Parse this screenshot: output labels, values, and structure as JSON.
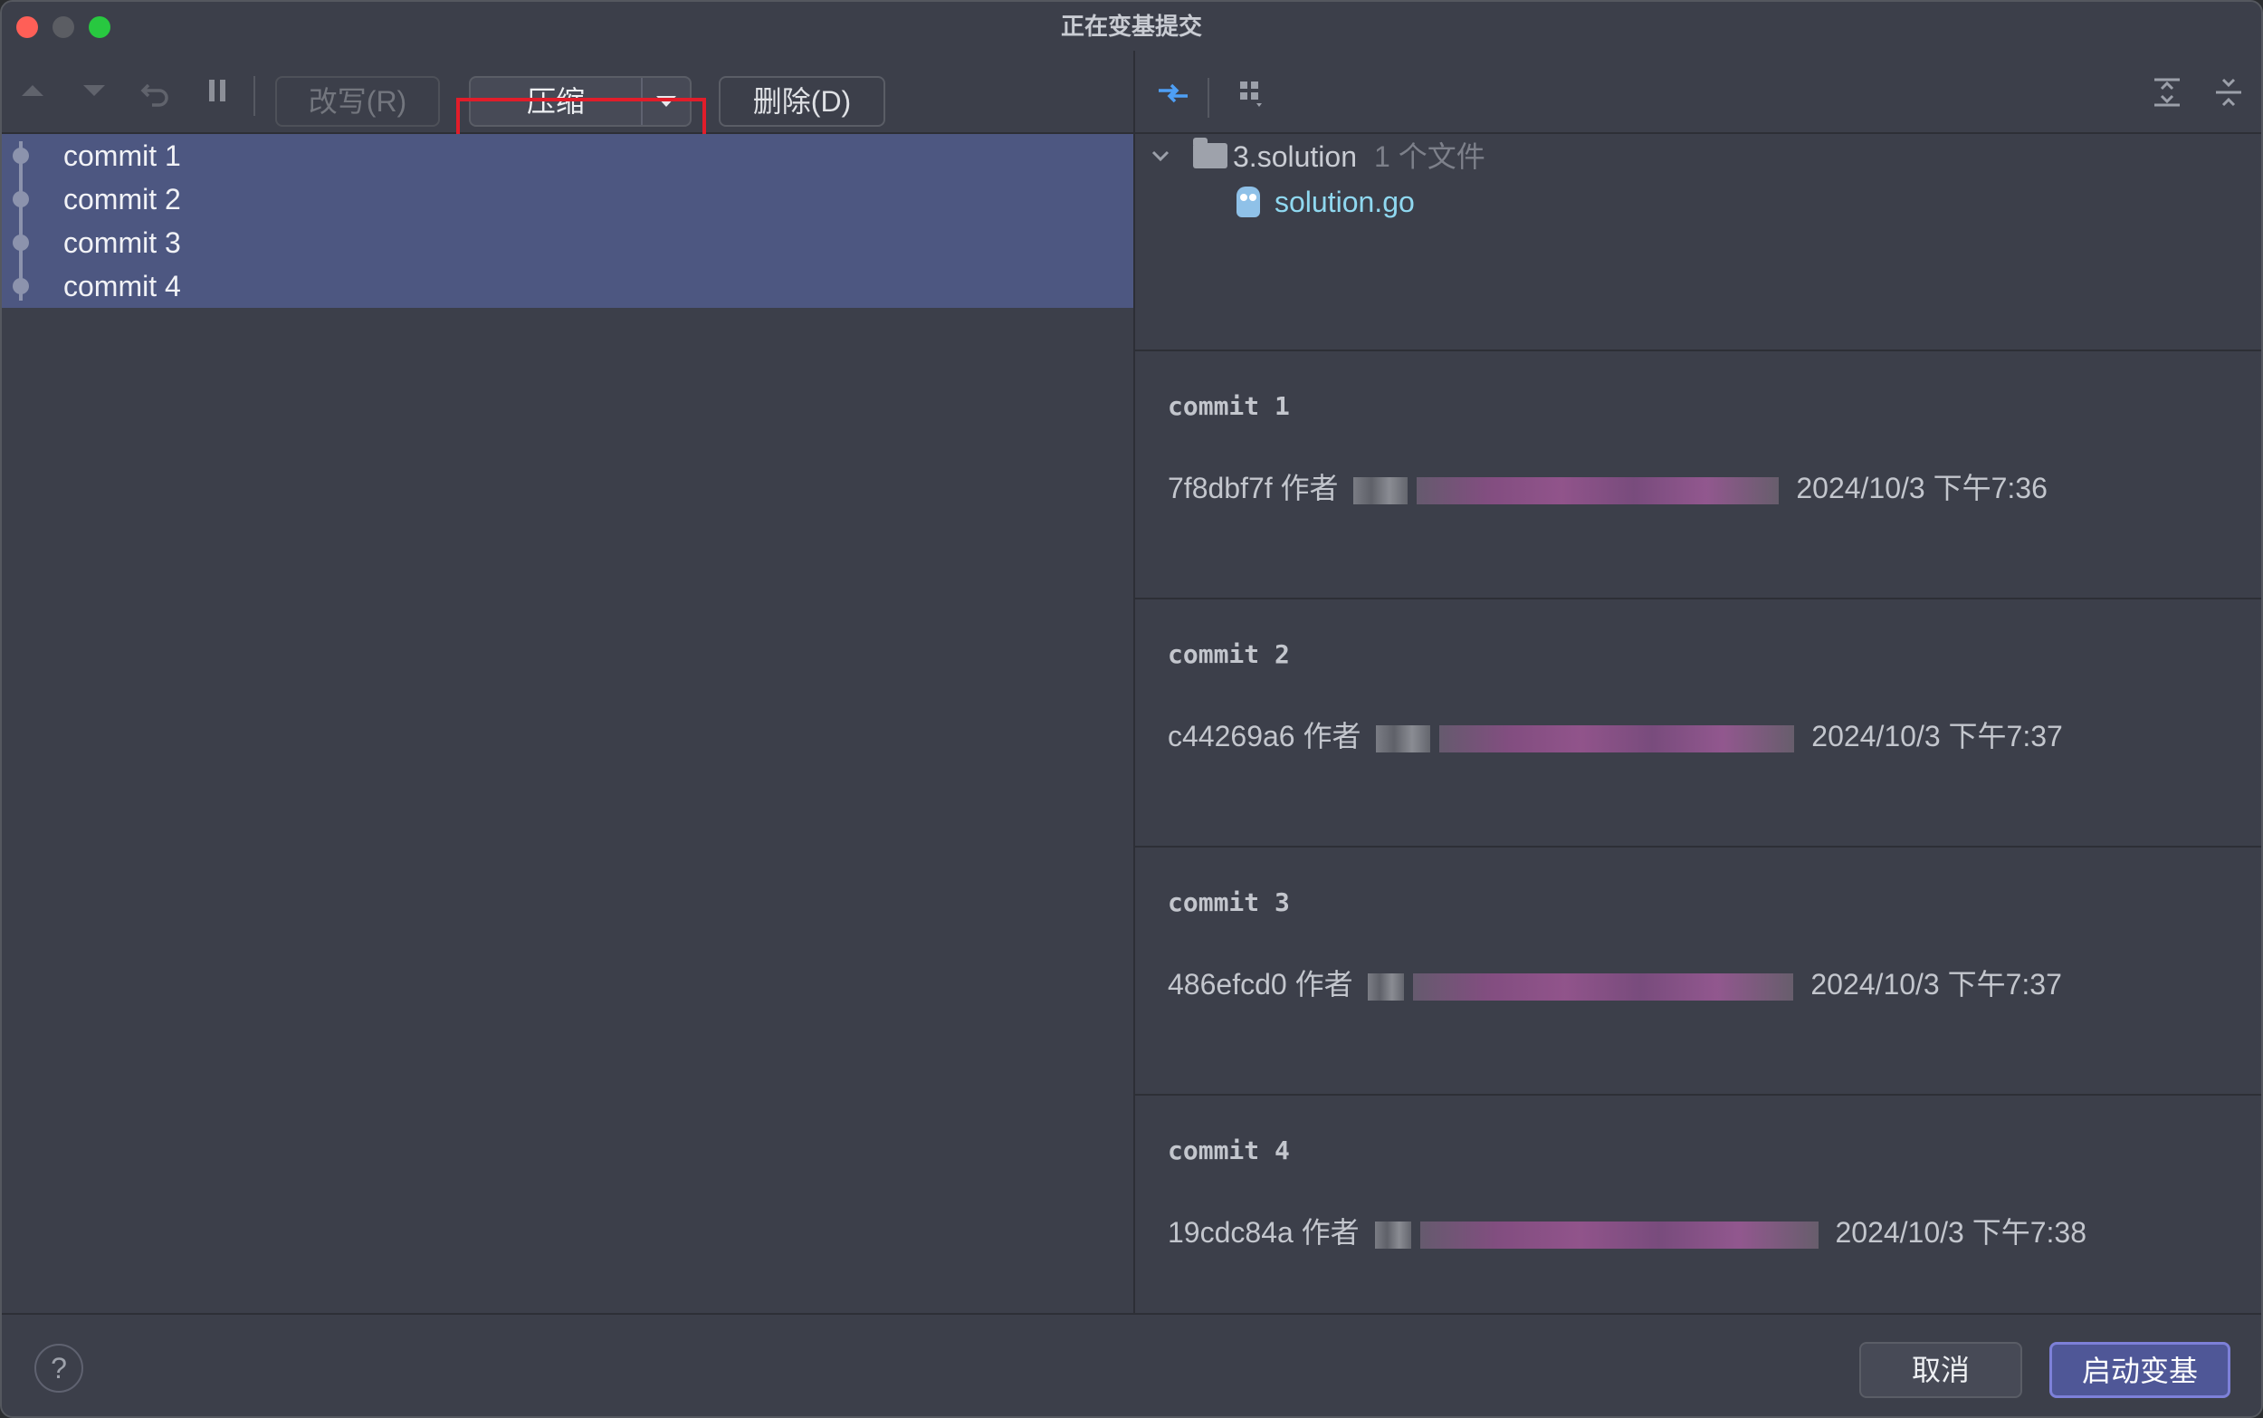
{
  "window": {
    "title": "正在变基提交"
  },
  "toolbar": {
    "reword_label": "改写(R)",
    "squash_label": "压缩",
    "delete_label": "删除(D)"
  },
  "commits": [
    {
      "label": "commit 1"
    },
    {
      "label": "commit 2"
    },
    {
      "label": "commit 3"
    },
    {
      "label": "commit 4"
    }
  ],
  "changes": {
    "folder_name": "3.solution",
    "folder_count": "1 个文件",
    "file_name": "solution.go"
  },
  "details": [
    {
      "title": "commit 1",
      "hash": "7f8dbf7f",
      "by": "作者",
      "time": "2024/10/3 下午7:36"
    },
    {
      "title": "commit 2",
      "hash": "c44269a6",
      "by": "作者",
      "time": "2024/10/3 下午7:37"
    },
    {
      "title": "commit 3",
      "hash": "486efcd0",
      "by": "作者",
      "time": "2024/10/3 下午7:37"
    },
    {
      "title": "commit 4",
      "hash": "19cdc84a",
      "by": "作者",
      "time": "2024/10/3 下午7:38"
    }
  ],
  "footer": {
    "help_label": "?",
    "cancel_label": "取消",
    "start_label": "启动变基"
  },
  "colors": {
    "selection": "#4d5781",
    "highlight_border": "#e11d2a",
    "primary_button": "#4f5797",
    "file_link": "#8fd8f0"
  }
}
